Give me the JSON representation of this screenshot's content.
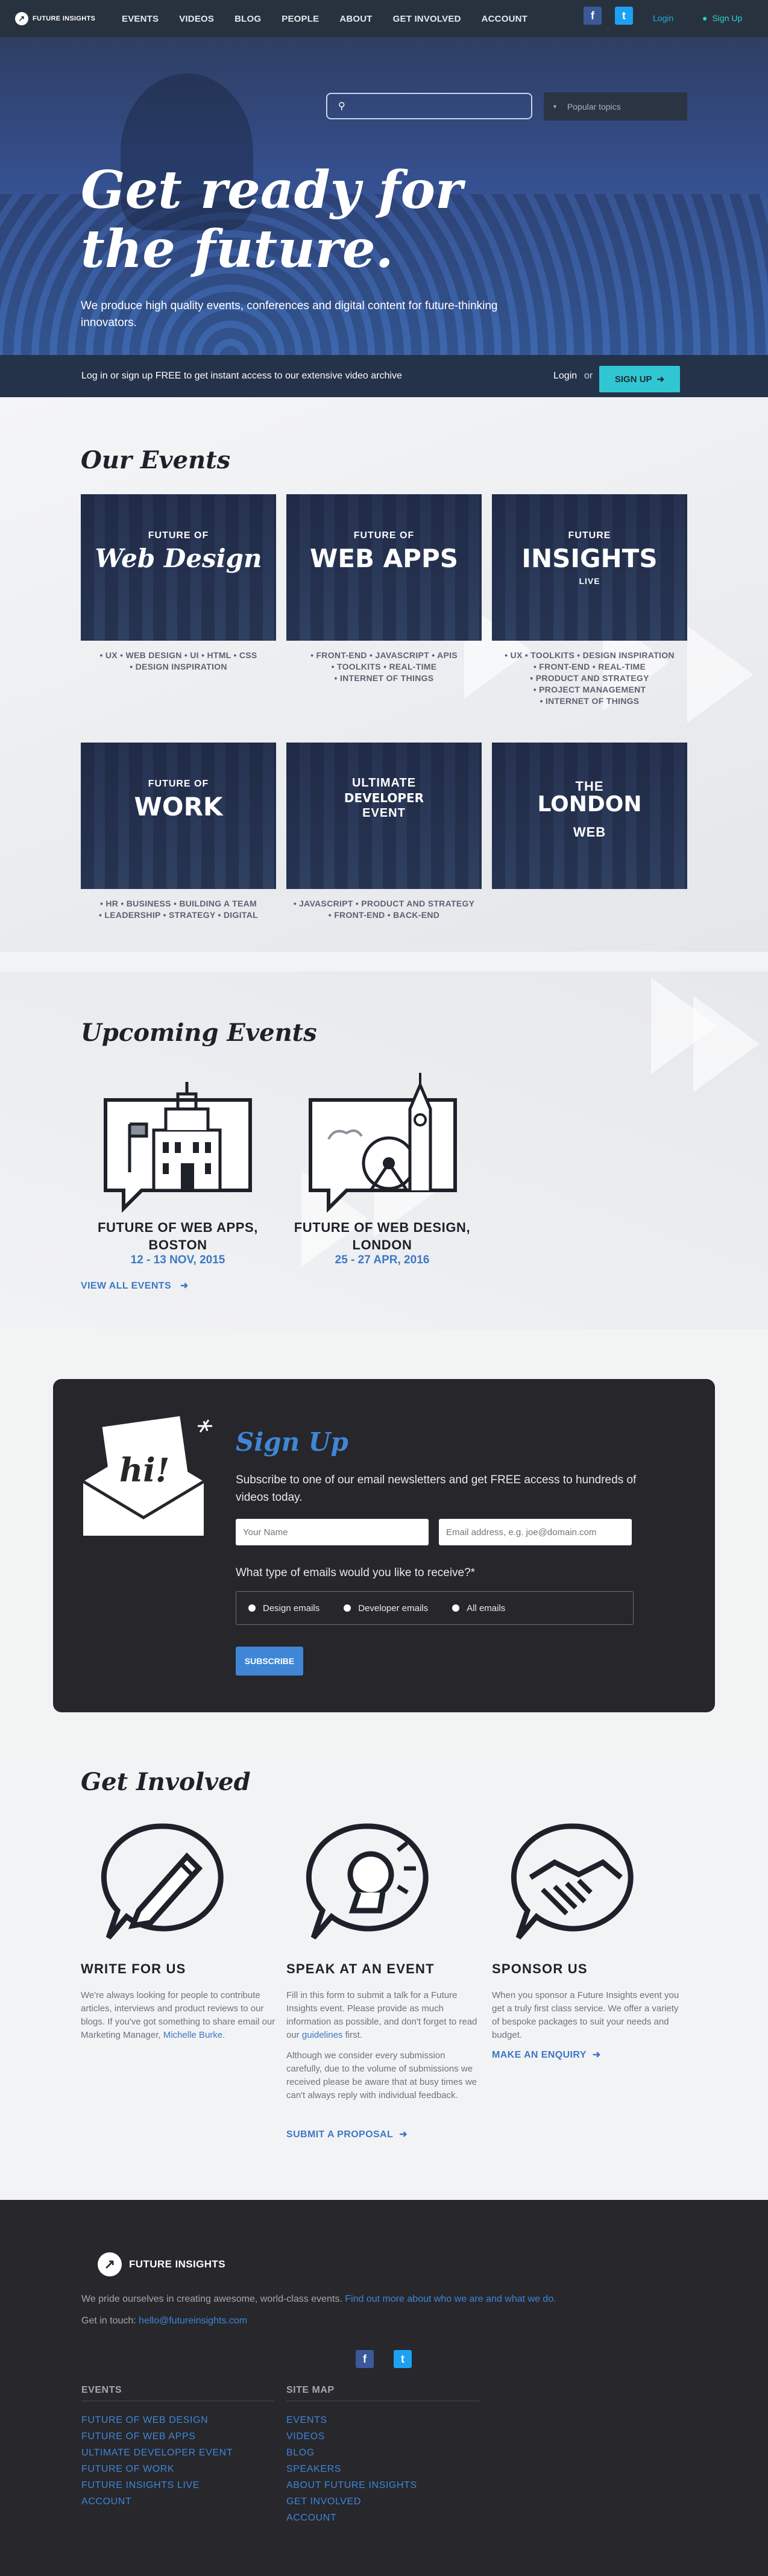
{
  "nav": {
    "logo_text": "FUTURE INSIGHTS",
    "items": [
      "EVENTS",
      "VIDEOS",
      "BLOG",
      "PEOPLE",
      "ABOUT",
      "GET INVOLVED",
      "ACCOUNT"
    ],
    "facebook": "f",
    "twitter": "t",
    "login": "Login",
    "signup": "Sign Up"
  },
  "hero": {
    "search_placeholder": "",
    "topics": "Popular topics",
    "title": "Get ready for the future.",
    "subtitle": "We produce high quality events, conferences and digital content for future-thinking innovators."
  },
  "bar": {
    "text": "Log in or sign up FREE to get instant access to our extensive video archive",
    "login": "Login",
    "or": "or",
    "button": "SIGN UP"
  },
  "events": {
    "title": "Our Events",
    "cards": [
      {
        "t1": "FUTURE OF",
        "t2": "Web Design",
        "t3": "",
        "tags": [
          "• UX • WEB DESIGN • UI • HTML • CSS",
          "• DESIGN INSPIRATION"
        ]
      },
      {
        "t1": "FUTURE OF",
        "t2": "WEB APPS",
        "t3": "",
        "tags": [
          "• FRONT-END • JAVASCRIPT • APIS",
          "• TOOLKITS • REAL-TIME",
          "• INTERNET OF THINGS"
        ]
      },
      {
        "t1": "FUTURE",
        "t2": "INSIGHTS",
        "t3": "LIVE",
        "tags": [
          "• UX • TOOLKITS • DESIGN INSPIRATION",
          "• FRONT-END • REAL-TIME",
          "• PRODUCT AND STRATEGY",
          "• PROJECT MANAGEMENT",
          "• INTERNET OF THINGS"
        ]
      },
      {
        "t1": "FUTURE OF",
        "t2": "WORK",
        "t3": "",
        "tags": [
          "• HR • BUSINESS • BUILDING A TEAM",
          "• LEADERSHIP • STRATEGY • DIGITAL"
        ]
      },
      {
        "t1": "ULTIMATE",
        "t2": "DEVELOPER",
        "t3": "EVENT",
        "tags": [
          "• JAVASCRIPT • PRODUCT AND STRATEGY",
          "• FRONT-END • BACK-END"
        ]
      },
      {
        "t1": "THE",
        "t2": "LONDON",
        "t3": "WEB",
        "tags": []
      }
    ]
  },
  "upcoming": {
    "title": "Upcoming Events",
    "items": [
      {
        "name": "FUTURE OF WEB APPS, BOSTON",
        "date": "12 - 13 NOV, 2015"
      },
      {
        "name": "FUTURE OF WEB DESIGN, LONDON",
        "date": "25 - 27 APR, 2016"
      }
    ],
    "view_all": "VIEW ALL EVENTS"
  },
  "signup": {
    "badge": "hi!",
    "title": "Sign Up",
    "desc": "Subscribe to one of our email newsletters and get FREE access to hundreds of videos today.",
    "name_placeholder": "Your Name",
    "email_placeholder": "Email address, e.g. joe@domain.com",
    "question": "What type of emails would you like to receive?*",
    "options": [
      "Design emails",
      "Developer emails",
      "All emails"
    ],
    "button": "SUBSCRIBE"
  },
  "involved": {
    "title": "Get Involved",
    "cols": [
      {
        "heading": "WRITE FOR US",
        "p1": "We're always looking for people to contribute articles, interviews and product reviews to our blogs. If you've got something to share email our Marketing Manager, ",
        "p1_link": "Michelle Burke",
        "p1_end": ".",
        "link": ""
      },
      {
        "heading": "SPEAK AT AN EVENT",
        "p1": "Fill in this form to submit a talk for a Future Insights event. Please provide as much information as possible, and don't forget to read our ",
        "p1_link": "guidelines",
        "p1_end": " first.",
        "p2": "Although we consider every submission carefully, due to the volume of submissions we received please be aware that at busy times we can't always reply with individual feedback.",
        "link": "SUBMIT A PROPOSAL"
      },
      {
        "heading": "SPONSOR US",
        "p1": "When you sponsor a Future Insights event you get a truly first class service. We offer a variety of bespoke packages to suit your needs and budget.",
        "p1_link": "",
        "p1_end": "",
        "link": "MAKE AN ENQUIRY"
      }
    ]
  },
  "footer": {
    "logo_text": "FUTURE INSIGHTS",
    "about": "We pride ourselves in creating awesome, world-class events. ",
    "about_link": "Find out more about who we are and what we do.",
    "contact": "Get in touch: ",
    "email": "hello@futureinsights.com",
    "events_heading": "EVENTS",
    "events": [
      "FUTURE OF WEB DESIGN",
      "FUTURE OF WEB APPS",
      "ULTIMATE DEVELOPER EVENT",
      "FUTURE OF WORK",
      "FUTURE INSIGHTS LIVE",
      "ACCOUNT"
    ],
    "sitemap_heading": "SITE MAP",
    "sitemap": [
      "EVENTS",
      "VIDEOS",
      "BLOG",
      "SPEAKERS",
      "ABOUT FUTURE INSIGHTS",
      "GET INVOLVED",
      "ACCOUNT"
    ]
  }
}
